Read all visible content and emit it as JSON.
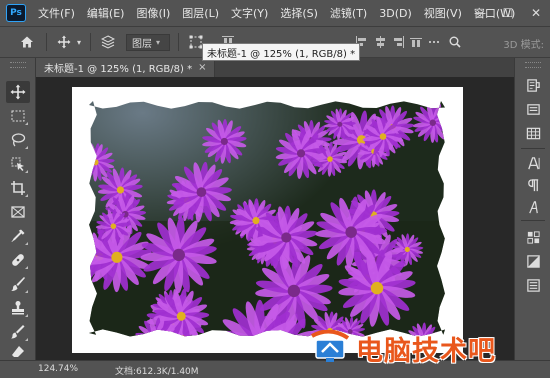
{
  "app": {
    "logo_text": "Ps"
  },
  "menu": [
    {
      "label": "文件(F)"
    },
    {
      "label": "编辑(E)"
    },
    {
      "label": "图像(I)"
    },
    {
      "label": "图层(L)"
    },
    {
      "label": "文字(Y)"
    },
    {
      "label": "选择(S)"
    },
    {
      "label": "滤镜(T)"
    },
    {
      "label": "3D(D)"
    },
    {
      "label": "视图(V)"
    },
    {
      "label": "窗口(W)"
    }
  ],
  "window_controls": {
    "minimize": "—",
    "maximize": "☐",
    "close": "✕"
  },
  "options_bar": {
    "layer_select": "图层",
    "tooltip": "未标题-1 @ 125% (1, RGB/8) *",
    "mode_3d": "3D 模式:"
  },
  "tab": {
    "title": "未标题-1 @ 125% (1, RGB/8) *",
    "close": "×"
  },
  "status": {
    "zoom": "124.74%",
    "doc_info": "文档:612.3K/1.40M",
    "arrow": "›"
  },
  "watermark": {
    "text": "电脑技术吧"
  },
  "colors": {
    "accent_blue": "#31a8ff",
    "watermark_orange": "#e9571c",
    "flower_purple": "#b43be0"
  }
}
